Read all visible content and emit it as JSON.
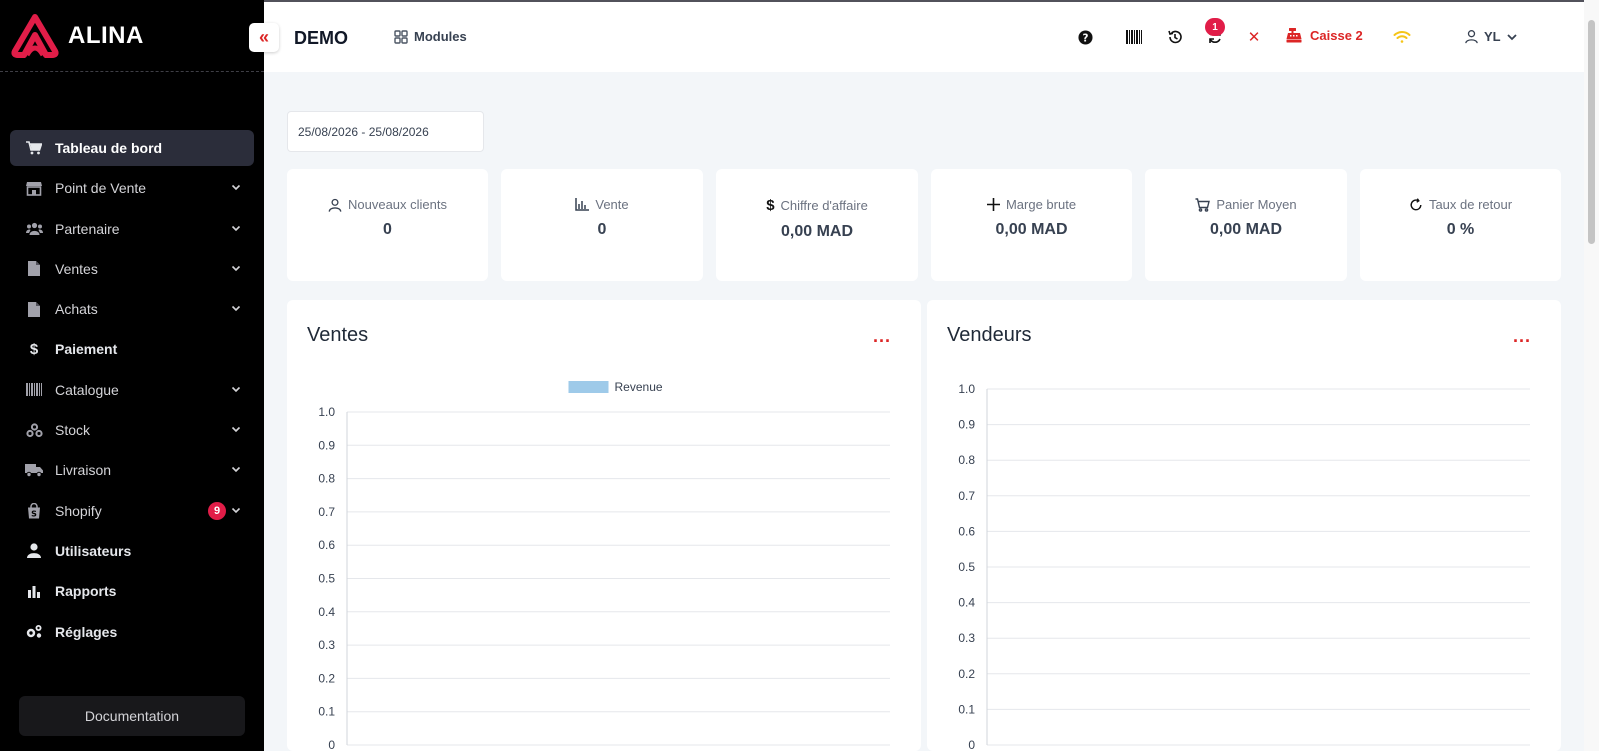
{
  "brand": {
    "name": "ALINA"
  },
  "sidebar": {
    "items": [
      {
        "label": "Tableau de bord",
        "icon": "cart-icon",
        "active": true,
        "chevron": false
      },
      {
        "label": "Point de Vente",
        "icon": "store-icon",
        "chevron": true
      },
      {
        "label": "Partenaire",
        "icon": "users-icon",
        "chevron": true
      },
      {
        "label": "Ventes",
        "icon": "file-icon",
        "chevron": true
      },
      {
        "label": "Achats",
        "icon": "file-icon",
        "chevron": true
      },
      {
        "label": "Paiement",
        "icon": "dollar-icon",
        "chevron": false
      },
      {
        "label": "Catalogue",
        "icon": "barcode-icon",
        "chevron": true
      },
      {
        "label": "Stock",
        "icon": "boxes-icon",
        "chevron": true
      },
      {
        "label": "Livraison",
        "icon": "truck-icon",
        "chevron": true
      },
      {
        "label": "Shopify",
        "icon": "shopping-bag-icon",
        "chevron": true,
        "badge": "9"
      },
      {
        "label": "Utilisateurs",
        "icon": "user-icon",
        "chevron": false
      },
      {
        "label": "Rapports",
        "icon": "bar-chart-icon",
        "chevron": false
      },
      {
        "label": "Réglages",
        "icon": "cogs-icon",
        "chevron": false
      }
    ],
    "documentation_label": "Documentation"
  },
  "header": {
    "title": "DEMO",
    "modules_label": "Modules",
    "sync_badge": "1",
    "caisse_label": "Caisse 2",
    "user_initials": "YL"
  },
  "filters": {
    "date_range": "25/08/2026 - 25/08/2026"
  },
  "kpis": [
    {
      "label": "Nouveaux clients",
      "value": "0",
      "icon": "user-outline-icon"
    },
    {
      "label": "Vente",
      "value": "0",
      "icon": "bar-chart-outline-icon"
    },
    {
      "label": "Chiffre d'affaire",
      "value": "0,00 MAD",
      "icon": "dollar-icon"
    },
    {
      "label": "Marge brute",
      "value": "0,00 MAD",
      "icon": "plus-icon"
    },
    {
      "label": "Panier Moyen",
      "value": "0,00 MAD",
      "icon": "cart-outline-icon"
    },
    {
      "label": "Taux de retour",
      "value": "0 %",
      "icon": "refresh-icon"
    }
  ],
  "colors": {
    "accent": "#dc2626",
    "sidebar_bg": "#000000",
    "revenue": "#9ecae9",
    "wifi": "#f5c518"
  },
  "panels": {
    "ventes_title": "Ventes",
    "vendeurs_title": "Vendeurs",
    "menu_label": "..."
  },
  "chart_data": [
    {
      "type": "bar",
      "categories": [],
      "series": [
        {
          "name": "Revenue",
          "values": []
        }
      ],
      "ylim": [
        0,
        1.0
      ],
      "yticks": [
        "1.0",
        "0.9",
        "0.8",
        "0.7",
        "0.6",
        "0.5",
        "0.4",
        "0.3",
        "0.2",
        "0.1",
        "0"
      ],
      "legend": "top-center",
      "grid": true
    },
    {
      "type": "bar",
      "categories": [],
      "series": [],
      "ylim": [
        0,
        1.0
      ],
      "yticks": [
        "1.0",
        "0.9",
        "0.8",
        "0.7",
        "0.6",
        "0.5",
        "0.4",
        "0.3",
        "0.2",
        "0.1",
        "0"
      ],
      "grid": true
    }
  ]
}
